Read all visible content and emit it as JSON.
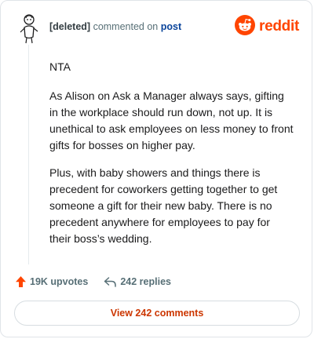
{
  "header": {
    "author": "[deleted]",
    "action": " commented on ",
    "post_link": "post",
    "brand": "reddit"
  },
  "comment": {
    "paragraphs": [
      "NTA",
      "As Alison on Ask a Manager always says, gifting in the workplace should run down, not up. It is unethical to ask employees on less money to front gifts for bosses on higher pay.",
      "Plus, with baby showers and things there is precedent for coworkers getting together to get someone a gift for their new baby. There is no precedent anywhere for employees to pay for their boss’s wedding."
    ]
  },
  "stats": {
    "upvotes": "19K upvotes",
    "replies": "242 replies"
  },
  "actions": {
    "view_comments": "View 242 comments"
  },
  "colors": {
    "brand": "#ff4500",
    "link": "#0a449b",
    "meta": "#576f76",
    "cta": "#cc3600"
  },
  "icons": {
    "avatar": "deleted-user-avatar-icon",
    "logo": "reddit-snoo-icon",
    "upvote": "upvote-arrow-icon",
    "reply": "reply-arrow-icon"
  }
}
